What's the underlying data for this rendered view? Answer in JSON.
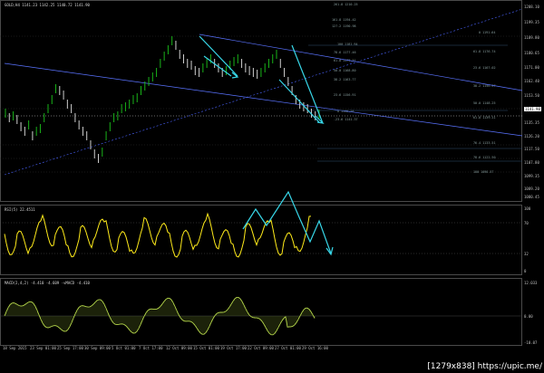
{
  "main_title": "GOLD,H4  1141.23 1142.25 1140.72 1141.90",
  "rsi_title": "RSI(5) 22.4511",
  "macd_title": "MACD(2,4,2) -4.410 -4.609  -vMACD -4.410",
  "price_labels": [
    "1208.10",
    "1199.35",
    "1189.80",
    "1180.65",
    "1171.00",
    "1162.40",
    "1153.50",
    "1145.30",
    "1135.35",
    "1126.20",
    "1117.50",
    "1107.80",
    "1099.35",
    "1089.20",
    "1080.45"
  ],
  "current_price": "1141.90",
  "rsi_labels": [
    "100",
    "70",
    "32",
    "0"
  ],
  "macd_labels": [
    "12.033",
    "0.00",
    "-10.07"
  ],
  "x_labels": [
    "18 Sep 2015",
    "23 Sep 01:00",
    "25 Sep 17:00",
    "30 Sep 09:00",
    "5 Oct 01:00",
    "7 Oct 17:00",
    "12 Oct 09:00",
    "15 Oct 01:00",
    "19 Oct 17:00",
    "22 Oct 09:00",
    "27 Oct 01:00",
    "29 Oct 16:00"
  ],
  "fib_left": [
    "261.8 1210.25",
    "161.8 1194.42",
    "127.2 1190.98",
    "100 1181.94",
    "78.6 1177.46",
    "61.8 1173.31",
    "50.0 1168.80",
    "38.2 1163.77",
    "23.6 1156.91",
    "0 1146.28",
    "-23.6 1141.37"
  ],
  "fib_right": [
    "0 1191.64",
    "61.8 1176.74",
    "23.6 1167.02",
    "38.2 1156.97",
    "50.0 1148.25",
    "61.8 1139.11",
    "76.4 1133.51",
    "78.6 1122.50",
    "100 1090.57"
  ],
  "watermark": "[1279x838] https://upic.me/"
}
